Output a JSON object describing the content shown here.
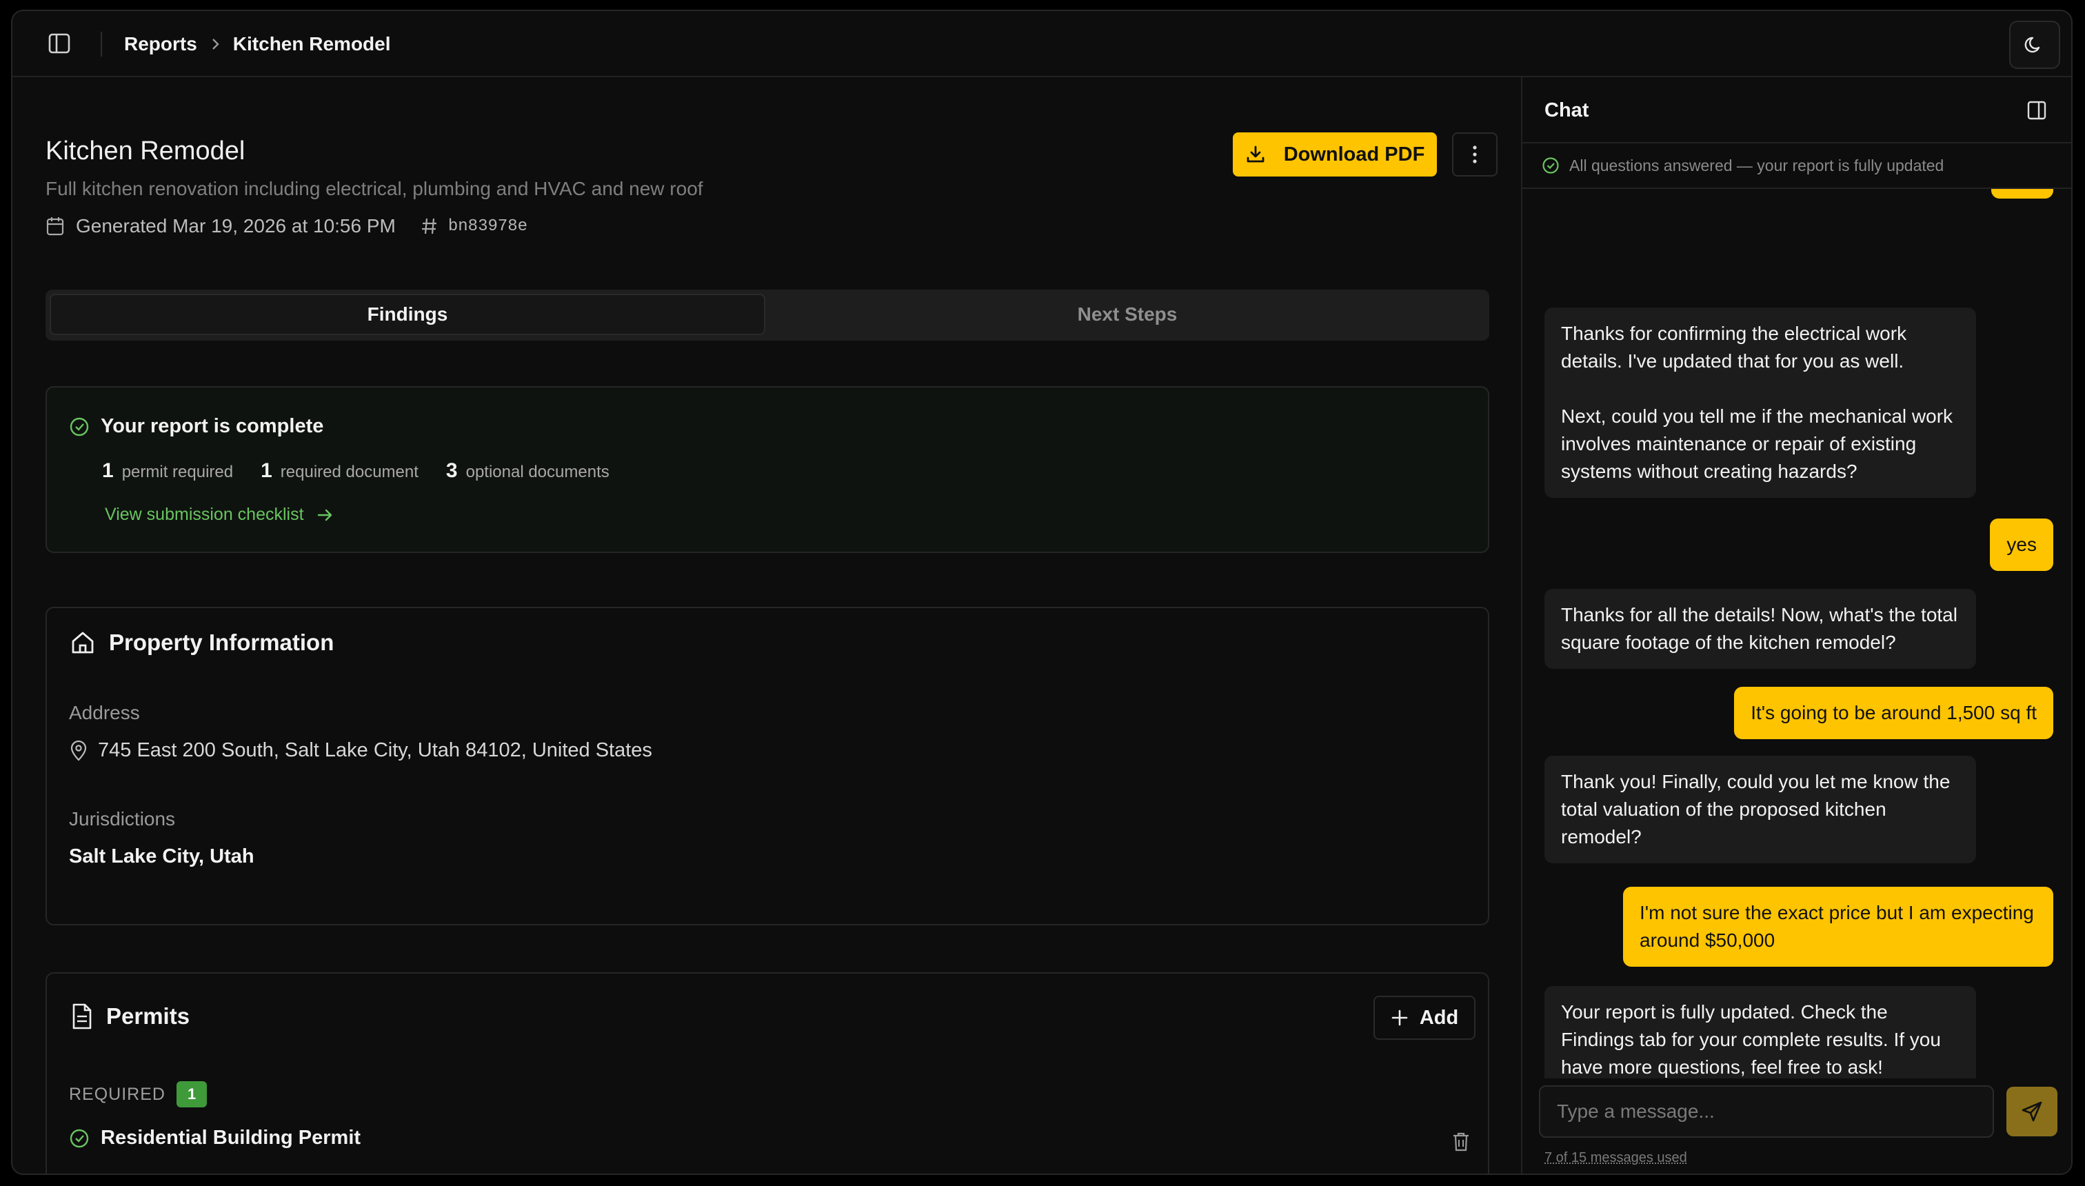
{
  "header": {
    "breadcrumb_root": "Reports",
    "breadcrumb_current": "Kitchen Remodel"
  },
  "report": {
    "title": "Kitchen Remodel",
    "subtitle": "Full kitchen renovation including electrical, plumbing and HVAC and new roof",
    "generated": "Generated Mar 19, 2026 at 10:56 PM",
    "id": "bn83978e",
    "download_label": "Download PDF"
  },
  "tabs": [
    {
      "label": "Findings",
      "active": true
    },
    {
      "label": "Next Steps",
      "active": false
    }
  ],
  "complete": {
    "title": "Your report is complete",
    "stats": [
      {
        "num": "1",
        "label": "permit required"
      },
      {
        "num": "1",
        "label": "required document"
      },
      {
        "num": "3",
        "label": "optional documents"
      }
    ],
    "link": "View submission checklist"
  },
  "property": {
    "title": "Property Information",
    "address_label": "Address",
    "address": "745 East 200 South, Salt Lake City, Utah 84102, United States",
    "jurisdictions_label": "Jurisdictions",
    "jurisdictions": "Salt Lake City, Utah"
  },
  "permits": {
    "title": "Permits",
    "add_label": "Add",
    "required_label": "REQUIRED",
    "required_count": "1",
    "items": [
      {
        "name": "Residential Building Permit"
      }
    ]
  },
  "chat": {
    "title": "Chat",
    "status": "All questions answered — your report is fully updated",
    "messages": [
      {
        "role": "bot",
        "text": "Thanks for confirming the electrical work details. I've updated that for you as well.\n\nNext, could you tell me if the mechanical work involves maintenance or repair of existing systems without creating hazards?"
      },
      {
        "role": "user",
        "text": "yes"
      },
      {
        "role": "bot",
        "text": "Thanks for all the details! Now, what's the total square footage of the kitchen remodel?"
      },
      {
        "role": "user",
        "text": "It's going to be around 1,500 sq ft"
      },
      {
        "role": "bot",
        "text": "Thank you! Finally, could you let me know the total valuation of the proposed kitchen remodel?"
      },
      {
        "role": "user",
        "text": "I'm not sure the exact price but I am expecting around $50,000"
      },
      {
        "role": "bot",
        "text": "Your report is fully updated. Check the Findings tab for your complete results. If you have more questions, feel free to ask!"
      }
    ],
    "input_placeholder": "Type a message...",
    "usage": "7 of 15 messages used"
  },
  "colors": {
    "accent": "#ffc400",
    "success": "#69c461",
    "background": "#0d0d0d"
  }
}
